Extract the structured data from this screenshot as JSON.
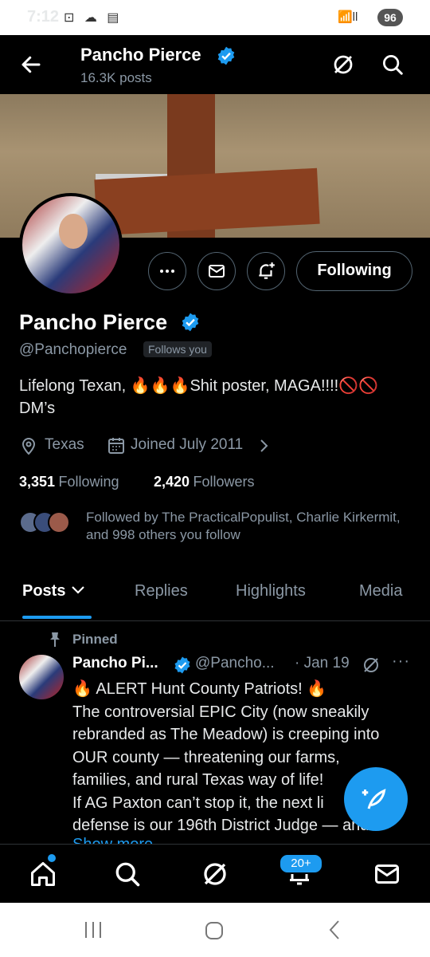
{
  "status_bar": {
    "time": "7:12",
    "left_icons": "⊡ ☁ ▤",
    "right_icons": "📶ll",
    "battery": "96"
  },
  "header": {
    "name": "Pancho Pierce",
    "posts": "16.3K posts"
  },
  "profile": {
    "name": "Pancho Pierce",
    "handle": "@Panchopierce",
    "follows_you": "Follows you",
    "bio": "Lifelong Texan, 🔥🔥🔥Shit poster, MAGA!!!!🚫🚫 DM’s",
    "location": "Texas",
    "joined": "Joined July 2011",
    "following_count": "3,351",
    "following_label": "Following",
    "followers_count": "2,420",
    "followers_label": "Followers",
    "followed_by": "Followed by The PracticalPopulist, Charlie Kirkermit, and 998 others you follow",
    "following_button": "Following"
  },
  "tabs": [
    {
      "label": "Posts"
    },
    {
      "label": "Replies"
    },
    {
      "label": "Highlights"
    },
    {
      "label": "Media"
    }
  ],
  "tweet": {
    "pinned_label": "Pinned",
    "name": "Pancho Pi...",
    "handle": "@Pancho...",
    "date": "· Jan 19",
    "more": "···",
    "body_lines": [
      "🔥 ALERT Hunt County Patriots! 🔥",
      "The controversial EPIC City (now sneakily",
      "rebranded as The Meadow) is creeping into",
      "OUR county — threatening our farms,",
      "families, and rural Texas way of life!",
      "If AG Paxton can’t stop it, the next li",
      "defense is our 196th District Judge — and"
    ],
    "show_more": "Show more"
  },
  "bottom_nav": {
    "notifications_badge": "20+"
  },
  "colors": {
    "accent": "#1d9bf0",
    "background": "#000000",
    "muted": "#8b98a5"
  },
  "icons": [
    "back-arrow-icon",
    "grok-icon",
    "search-icon",
    "more-icon",
    "mail-icon",
    "notify-bell-icon",
    "location-icon",
    "calendar-icon",
    "pin-icon",
    "home-icon",
    "bell-icon",
    "compose-icon"
  ]
}
